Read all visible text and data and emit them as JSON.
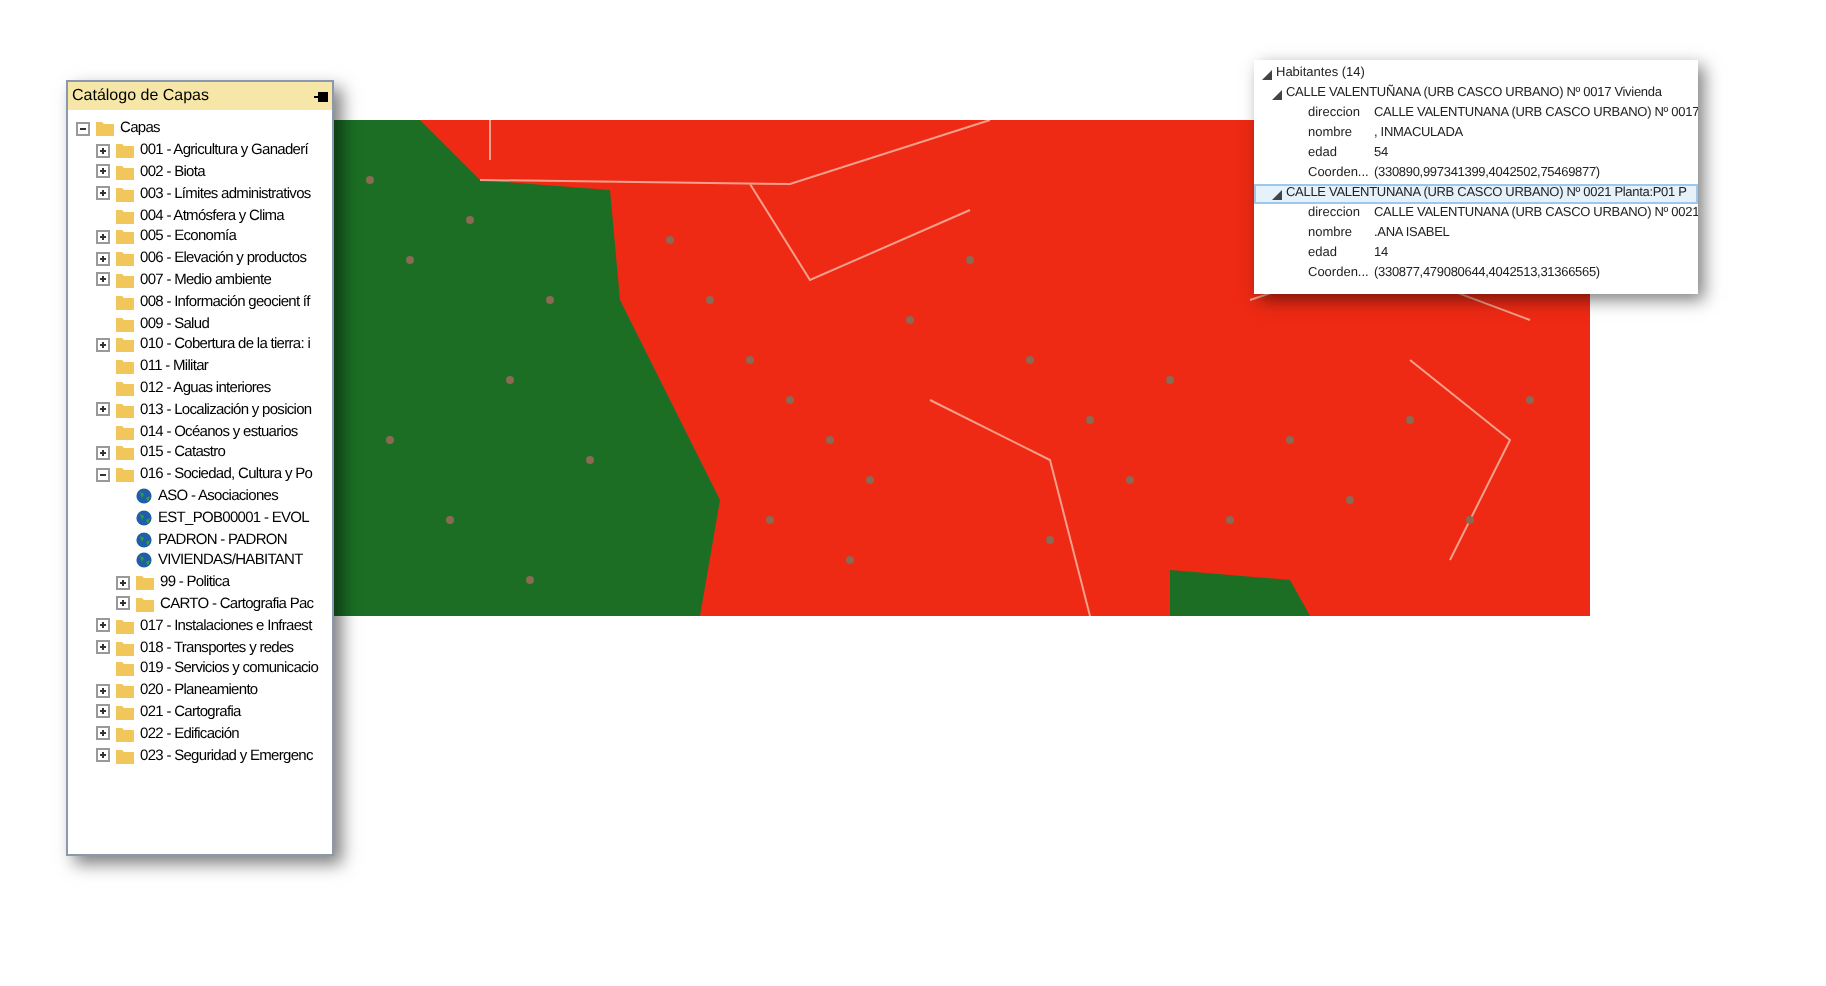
{
  "catalog": {
    "title": "Catálogo de Capas",
    "tree": [
      {
        "label": "Capas",
        "kind": "folder",
        "expanded": true,
        "children": [
          {
            "label": "001 - Agricultura y Ganaderí",
            "kind": "folder",
            "expanded": false
          },
          {
            "label": "002 - Biota",
            "kind": "folder",
            "expanded": false
          },
          {
            "label": "003 - Límites administrativos",
            "kind": "folder",
            "expanded": false
          },
          {
            "label": "004 - Atmósfera y Clima",
            "kind": "folder"
          },
          {
            "label": "005 - Economía",
            "kind": "folder",
            "expanded": false
          },
          {
            "label": "006 - Elevación y productos",
            "kind": "folder",
            "expanded": false
          },
          {
            "label": "007 - Medio ambiente",
            "kind": "folder",
            "expanded": false
          },
          {
            "label": "008 - Información geocient íf",
            "kind": "folder"
          },
          {
            "label": "009 - Salud",
            "kind": "folder"
          },
          {
            "label": "010 - Cobertura de la tierra: i",
            "kind": "folder",
            "expanded": false
          },
          {
            "label": "011 - Militar",
            "kind": "folder"
          },
          {
            "label": "012 - Aguas interiores",
            "kind": "folder"
          },
          {
            "label": "013 - Localización y posicion",
            "kind": "folder",
            "expanded": false
          },
          {
            "label": "014 - Océanos y estuarios",
            "kind": "folder"
          },
          {
            "label": "015 - Catastro",
            "kind": "folder",
            "expanded": false
          },
          {
            "label": "016 - Sociedad, Cultura y Po",
            "kind": "folder",
            "expanded": true,
            "children": [
              {
                "label": "ASO - Asociaciones",
                "kind": "layer"
              },
              {
                "label": "EST_POB00001 - EVOL",
                "kind": "layer"
              },
              {
                "label": "PADRON - PADRON",
                "kind": "layer"
              },
              {
                "label": "VIVIENDAS/HABITANT",
                "kind": "layer"
              },
              {
                "label": "99 - Politica",
                "kind": "folder",
                "expanded": false
              },
              {
                "label": "CARTO - Cartografia Pac",
                "kind": "folder",
                "expanded": false
              }
            ]
          },
          {
            "label": "017 - Instalaciones e Infraest",
            "kind": "folder",
            "expanded": false
          },
          {
            "label": "018 - Transportes y redes",
            "kind": "folder",
            "expanded": false
          },
          {
            "label": "019 - Servicios y comunicacio",
            "kind": "folder"
          },
          {
            "label": "020 - Planeamiento",
            "kind": "folder",
            "expanded": false
          },
          {
            "label": "021 - Cartografia",
            "kind": "folder",
            "expanded": false
          },
          {
            "label": "022 - Edificación",
            "kind": "folder",
            "expanded": false
          },
          {
            "label": "023 - Seguridad y Emergenc",
            "kind": "folder",
            "expanded": false
          }
        ]
      }
    ]
  },
  "info": {
    "group": {
      "label": "Habitantes (14)",
      "expanded": true
    },
    "records": [
      {
        "label": "CALLE VALENTUÑANA (URB CASCO URBANO) Nº 0017 Vivienda",
        "expanded": true,
        "selected": false,
        "fields": [
          {
            "key": "direccion",
            "value": "CALLE VALENTUNANA (URB CASCO URBANO) Nº 0017"
          },
          {
            "key": "nombre",
            "value": ", INMACULADA"
          },
          {
            "key": "edad",
            "value": "54"
          },
          {
            "key": "Coorden...",
            "value": "(330890,997341399,4042502,75469877)"
          }
        ]
      },
      {
        "label": "CALLE VALENTUNANA (URB CASCO URBANO) Nº 0021 Planta:P01 P",
        "expanded": true,
        "selected": true,
        "fields": [
          {
            "key": "direccion",
            "value": "CALLE VALENTUNANA (URB CASCO URBANO) Nº 0021"
          },
          {
            "key": "nombre",
            "value": ".ANA ISABEL"
          },
          {
            "key": "edad",
            "value": "14"
          },
          {
            "key": "Coorden...",
            "value": "(330877,479080644,4042513,31366565)"
          }
        ]
      }
    ]
  }
}
